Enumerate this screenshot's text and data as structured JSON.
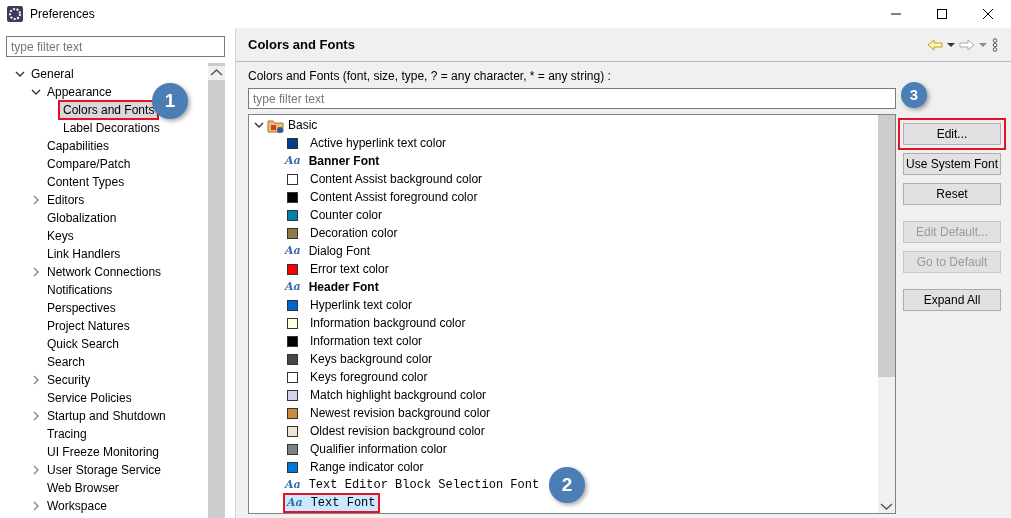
{
  "window": {
    "title": "Preferences"
  },
  "sidebar": {
    "filter": {
      "placeholder": "type filter text"
    },
    "items": [
      {
        "label": "General",
        "expanded": true,
        "selected": false,
        "children": [
          {
            "label": "Appearance",
            "expanded": true,
            "selected": false,
            "children": [
              {
                "label": "Colors and Fonts",
                "selected": true,
                "outlined": true,
                "callout": "1"
              },
              {
                "label": "Label Decorations",
                "selected": false
              }
            ]
          },
          {
            "label": "Capabilities",
            "selected": false
          },
          {
            "label": "Compare/Patch",
            "selected": false
          },
          {
            "label": "Content Types",
            "selected": false
          },
          {
            "label": "Editors",
            "expanded": false,
            "selected": false
          },
          {
            "label": "Globalization",
            "selected": false
          },
          {
            "label": "Keys",
            "selected": false
          },
          {
            "label": "Link Handlers",
            "selected": false
          },
          {
            "label": "Network Connections",
            "expanded": false,
            "selected": false
          },
          {
            "label": "Notifications",
            "selected": false
          },
          {
            "label": "Perspectives",
            "selected": false
          },
          {
            "label": "Project Natures",
            "selected": false
          },
          {
            "label": "Quick Search",
            "selected": false
          },
          {
            "label": "Search",
            "selected": false
          },
          {
            "label": "Security",
            "expanded": false,
            "selected": false
          },
          {
            "label": "Service Policies",
            "selected": false
          },
          {
            "label": "Startup and Shutdown",
            "expanded": false,
            "selected": false
          },
          {
            "label": "Tracing",
            "selected": false
          },
          {
            "label": "UI Freeze Monitoring",
            "selected": false
          },
          {
            "label": "User Storage Service",
            "expanded": false,
            "selected": false
          },
          {
            "label": "Web Browser",
            "selected": false
          },
          {
            "label": "Workspace",
            "expanded": false,
            "selected": false
          }
        ]
      }
    ]
  },
  "page": {
    "title": "Colors and Fonts",
    "description": "Colors and Fonts (font, size, type, ? = any character, * = any string) :",
    "filter": {
      "placeholder": "type filter text"
    },
    "tree": [
      {
        "label": "Basic",
        "expanded": true,
        "children": [
          {
            "kind": "color",
            "label": "Active hyperlink text color",
            "color": "#00428a",
            "selected": false
          },
          {
            "kind": "boldfont",
            "icon": "Aa",
            "label": "Banner Font",
            "selected": false
          },
          {
            "kind": "color",
            "label": "Content Assist background color",
            "color": "#ffffff",
            "selected": false
          },
          {
            "kind": "color",
            "label": "Content Assist foreground color",
            "color": "#000000",
            "selected": false
          },
          {
            "kind": "color",
            "label": "Counter color",
            "color": "#0080aa",
            "selected": false
          },
          {
            "kind": "color",
            "label": "Decoration color",
            "color": "#8c7a48",
            "selected": false
          },
          {
            "kind": "font",
            "icon": "Aa",
            "label": "Dialog Font",
            "selected": false
          },
          {
            "kind": "color",
            "label": "Error text color",
            "color": "#ff0000",
            "selected": false
          },
          {
            "kind": "boldfont",
            "icon": "Aa",
            "label": "Header Font",
            "selected": false
          },
          {
            "kind": "color",
            "label": "Hyperlink text color",
            "color": "#0066cc",
            "selected": false
          },
          {
            "kind": "color",
            "label": "Information background color",
            "color": "#ffffe1",
            "selected": false
          },
          {
            "kind": "color",
            "label": "Information text color",
            "color": "#000000",
            "selected": false
          },
          {
            "kind": "color",
            "label": "Keys background color",
            "color": "#464646",
            "selected": false
          },
          {
            "kind": "color",
            "label": "Keys foreground color",
            "color": "#ffffff",
            "selected": false
          },
          {
            "kind": "color",
            "label": "Match highlight background color",
            "color": "#d2d2f0",
            "selected": false
          },
          {
            "kind": "color",
            "label": "Newest revision background color",
            "color": "#c88a40",
            "selected": false
          },
          {
            "kind": "color",
            "label": "Oldest revision background color",
            "color": "#f0e2d4",
            "selected": false
          },
          {
            "kind": "color",
            "label": "Qualifier information color",
            "color": "#808080",
            "selected": false
          },
          {
            "kind": "color",
            "label": "Range indicator color",
            "color": "#0078d7",
            "selected": false
          },
          {
            "kind": "monofont",
            "icon": "Aa",
            "label": "Text Editor Block Selection Font",
            "selected": false,
            "callout": "2"
          },
          {
            "kind": "monofont",
            "icon": "Aa",
            "label": "Text Font",
            "selected": true,
            "outlined": true
          }
        ]
      }
    ],
    "buttons": [
      {
        "label": "Edit...",
        "disabled": false,
        "outlined": true,
        "callout": "3"
      },
      {
        "label": "Use System Font",
        "disabled": false
      },
      {
        "label": "Reset",
        "disabled": false
      },
      {
        "label": "Edit Default...",
        "disabled": true
      },
      {
        "label": "Go to Default",
        "disabled": true
      },
      {
        "label": "Expand All",
        "disabled": false
      }
    ]
  }
}
